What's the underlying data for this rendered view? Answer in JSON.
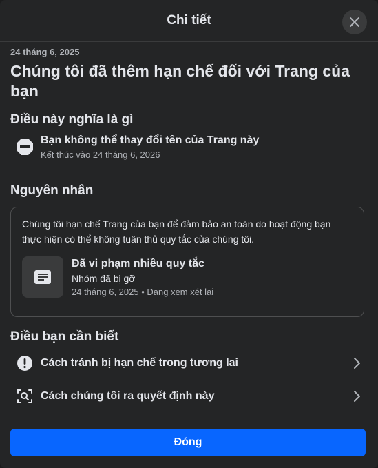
{
  "header": {
    "title": "Chi tiết",
    "close_icon": "close-icon"
  },
  "notice": {
    "date": "24 tháng 6, 2025",
    "title": "Chúng tôi đã thêm hạn chế đối với Trang của bạn"
  },
  "meaning": {
    "title": "Điều này nghĩa là gì",
    "item": {
      "icon": "no-entry-icon",
      "label": "Bạn không thể thay đổi tên của Trang này",
      "sub": "Kết thúc vào 24 tháng 6, 2026"
    }
  },
  "reason": {
    "title": "Nguyên nhân",
    "text": "Chúng tôi hạn chế Trang của bạn để đảm bảo an toàn do hoạt động bạn thực hiện có thể không tuân thủ quy tắc của chúng tôi.",
    "violation": {
      "icon": "document-lines-icon",
      "title": "Đã vi phạm nhiều quy tắc",
      "sub": "Nhóm đã bị gỡ",
      "meta": "24 tháng 6, 2025 • Đang xem xét lại"
    }
  },
  "info": {
    "title": "Điều bạn cần biết",
    "links": [
      {
        "icon": "exclamation-circle-icon",
        "label": "Cách tránh bị hạn chế trong tương lai"
      },
      {
        "icon": "search-scan-icon",
        "label": "Cách chúng tôi ra quyết định này"
      }
    ]
  },
  "footer": {
    "button_label": "Đóng"
  },
  "colors": {
    "background": "#242526",
    "primary_button": "#0866ff",
    "text_primary": "#e4e6eb",
    "text_secondary": "#b0b3b8"
  }
}
